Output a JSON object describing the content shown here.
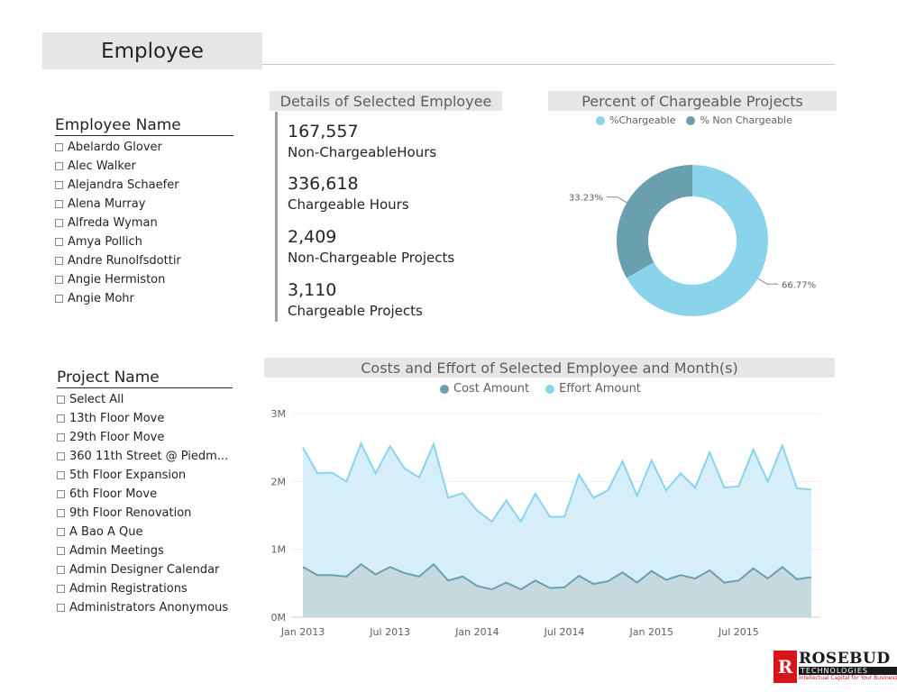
{
  "page": {
    "title": "Employee"
  },
  "employee_slicer": {
    "header": "Employee Name",
    "items": [
      "Abelardo Glover",
      "Alec Walker",
      "Alejandra Schaefer",
      "Alena Murray",
      "Alfreda Wyman",
      "Amya Pollich",
      "Andre Runolfsdottir",
      "Angie Hermiston",
      "Angie Mohr"
    ]
  },
  "project_slicer": {
    "header": "Project Name",
    "items": [
      "Select All",
      "13th Floor Move",
      "29th Floor Move",
      "360 11th Street @ Piedm...",
      "5th Floor Expansion",
      "6th Floor Move",
      "9th Floor Renovation",
      "A Bao A Que",
      "Admin Meetings",
      "Admin Designer Calendar",
      "Admin Registrations",
      "Administrators Anonymous"
    ]
  },
  "details": {
    "header": "Details of Selected Employee",
    "kpis": [
      {
        "value": "167,557",
        "label": "Non-ChargeableHours"
      },
      {
        "value": "336,618",
        "label": "Chargeable Hours"
      },
      {
        "value": "2,409",
        "label": "Non-Chargeable Projects"
      },
      {
        "value": "3,110",
        "label": "Chargeable Projects"
      }
    ]
  },
  "donut": {
    "header": "Percent of Chargeable Projects",
    "legend": [
      "%Chargeable",
      "% Non Chargeable"
    ]
  },
  "area_chart": {
    "header": "Costs and Effort of Selected Employee and Month(s)",
    "legend": [
      "Cost Amount",
      "Effort Amount"
    ]
  },
  "logo": {
    "name": "ROSEBUD",
    "sub": "TECHNOLOGIES",
    "tagline": "Intellectual Capital for Your Business",
    "mark": "R"
  },
  "colors": {
    "chargeable": "#8ad4eb",
    "non_chargeable": "#6a9fb0",
    "effort_line": "#8ad4eb",
    "effort_fill": "#d3edf7",
    "cost_line": "#6a9fb0",
    "cost_fill": "#c5d7dd"
  },
  "chart_data": [
    {
      "type": "pie",
      "title": "Percent of Chargeable Projects",
      "categories": [
        "%Chargeable",
        "% Non Chargeable"
      ],
      "values": [
        66.77,
        33.23
      ],
      "data_labels": [
        "66.77%",
        "33.23%"
      ]
    },
    {
      "type": "area",
      "title": "Costs and Effort of Selected Employee and Month(s)",
      "x_ticks": [
        "Jan 2013",
        "Jul 2013",
        "Jan 2014",
        "Jul 2014",
        "Jan 2015",
        "Jul 2015"
      ],
      "y_ticks": [
        "0M",
        "1M",
        "2M",
        "3M"
      ],
      "ylim": [
        0,
        3000000
      ],
      "x": [
        "2013-01",
        "2013-02",
        "2013-03",
        "2013-04",
        "2013-05",
        "2013-06",
        "2013-07",
        "2013-08",
        "2013-09",
        "2013-10",
        "2013-11",
        "2013-12",
        "2014-01",
        "2014-02",
        "2014-03",
        "2014-04",
        "2014-05",
        "2014-06",
        "2014-07",
        "2014-08",
        "2014-09",
        "2014-10",
        "2014-11",
        "2014-12",
        "2015-01",
        "2015-02",
        "2015-03",
        "2015-04",
        "2015-05",
        "2015-06",
        "2015-07",
        "2015-08",
        "2015-09",
        "2015-10",
        "2015-11",
        "2015-12"
      ],
      "series": [
        {
          "name": "Effort Amount",
          "values": [
            2500000,
            2120000,
            2130000,
            2000000,
            2560000,
            2120000,
            2520000,
            2190000,
            2060000,
            2550000,
            1760000,
            1830000,
            1570000,
            1410000,
            1720000,
            1410000,
            1820000,
            1480000,
            1480000,
            2100000,
            1760000,
            1870000,
            2300000,
            1790000,
            2310000,
            1870000,
            2120000,
            1910000,
            2430000,
            1910000,
            1930000,
            2470000,
            2000000,
            2530000,
            1900000,
            1880000
          ]
        },
        {
          "name": "Cost Amount",
          "values": [
            740000,
            620000,
            620000,
            600000,
            780000,
            630000,
            740000,
            650000,
            600000,
            780000,
            540000,
            600000,
            460000,
            410000,
            510000,
            410000,
            540000,
            430000,
            440000,
            610000,
            490000,
            530000,
            660000,
            510000,
            680000,
            550000,
            620000,
            570000,
            690000,
            510000,
            540000,
            720000,
            570000,
            740000,
            560000,
            590000
          ]
        }
      ]
    }
  ]
}
